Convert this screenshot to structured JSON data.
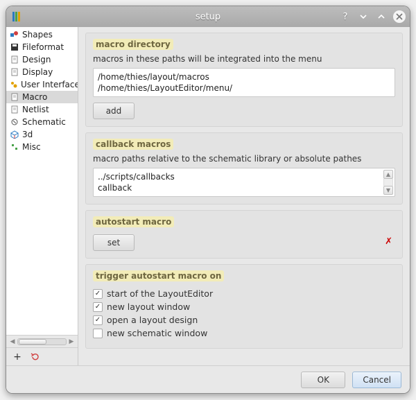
{
  "window": {
    "title": "setup"
  },
  "sidebar": {
    "items": [
      {
        "icon": "shapes",
        "label": "Shapes",
        "selected": false
      },
      {
        "icon": "disk",
        "label": "Fileformat",
        "selected": false
      },
      {
        "icon": "doc",
        "label": "Design",
        "selected": false
      },
      {
        "icon": "doc",
        "label": "Display",
        "selected": false
      },
      {
        "icon": "ui",
        "label": "User Interface",
        "selected": false
      },
      {
        "icon": "doc",
        "label": "Macro",
        "selected": true
      },
      {
        "icon": "doc",
        "label": "Netlist",
        "selected": false
      },
      {
        "icon": "schem",
        "label": "Schematic",
        "selected": false
      },
      {
        "icon": "3d",
        "label": "3d",
        "selected": false
      },
      {
        "icon": "misc",
        "label": "Misc",
        "selected": false
      }
    ]
  },
  "groups": {
    "macro_directory": {
      "title": "macro directory",
      "desc": "macros in these paths will be integrated into the menu",
      "paths": [
        "/home/thies/layout/macros",
        "/home/thies/LayoutEditor/menu/"
      ],
      "add_label": "add"
    },
    "callback_macros": {
      "title": "callback macros",
      "desc": "macro paths relative to the schematic library or absolute pathes",
      "paths": [
        "../scripts/callbacks",
        "callback"
      ]
    },
    "autostart": {
      "title": "autostart macro",
      "set_label": "set",
      "clear_glyph": "✗"
    },
    "trigger": {
      "title": "trigger autostart macro on",
      "options": [
        {
          "label": "start of the LayoutEditor",
          "checked": true
        },
        {
          "label": "new layout window",
          "checked": true
        },
        {
          "label": "open a layout design",
          "checked": true
        },
        {
          "label": "new schematic window",
          "checked": false
        }
      ]
    }
  },
  "footer": {
    "ok": "OK",
    "cancel": "Cancel"
  },
  "toolbar": {
    "plus": "+"
  }
}
